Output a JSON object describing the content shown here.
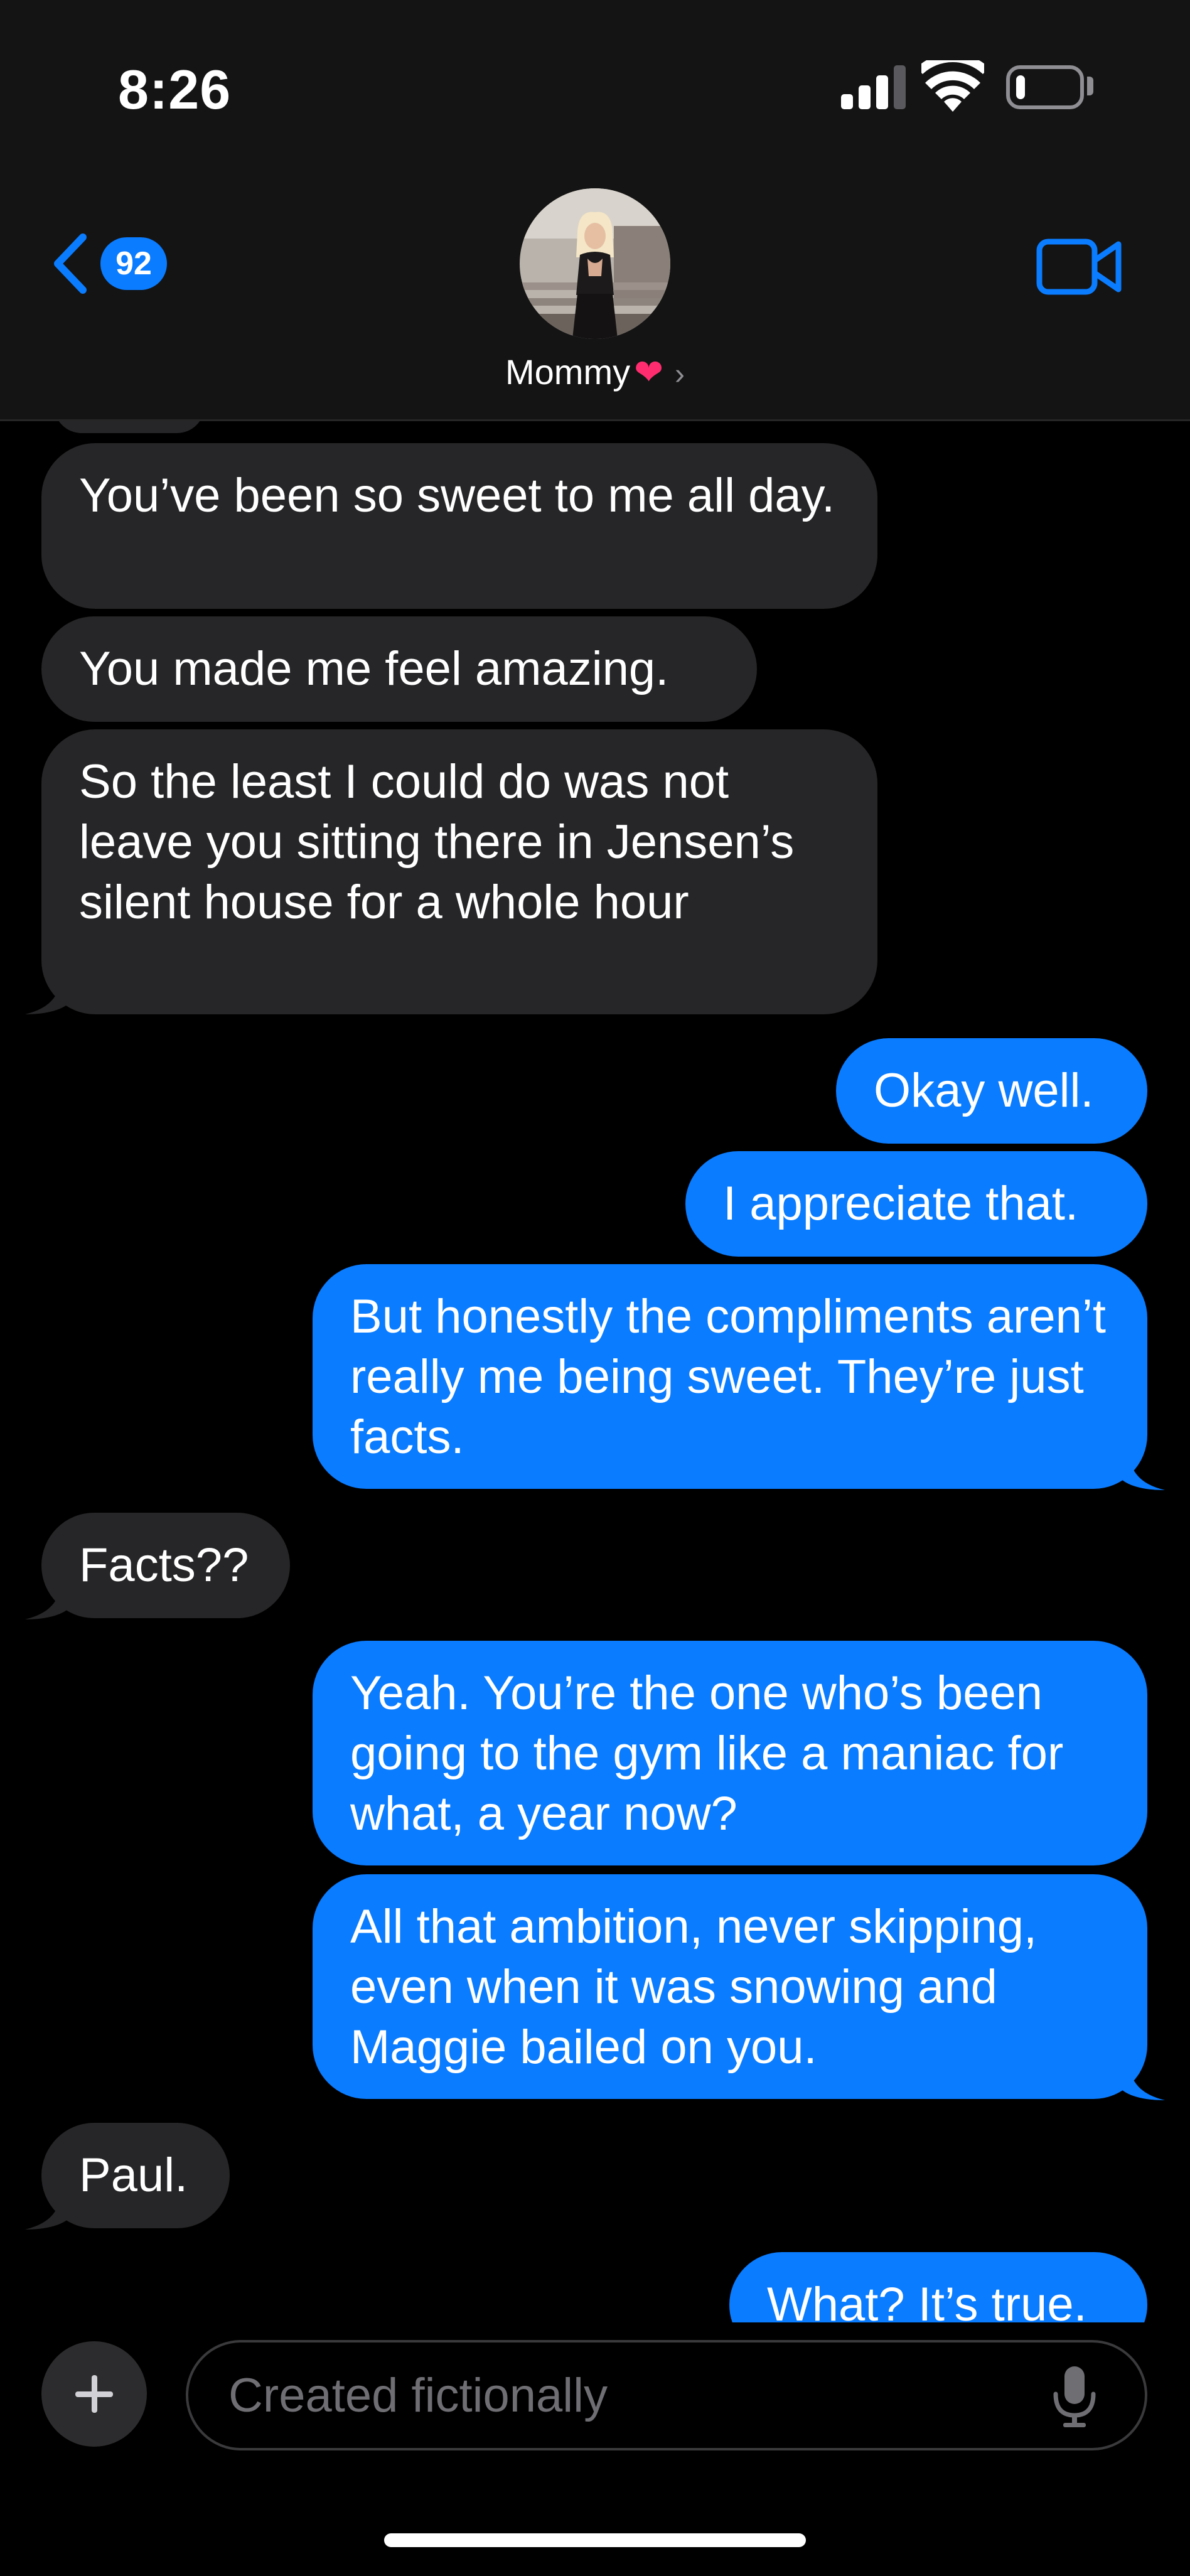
{
  "status_bar": {
    "time": "8:26",
    "signal_icon": "cellular-signal-icon",
    "wifi_icon": "wifi-icon",
    "battery_icon": "battery-icon",
    "battery_level": 0.15
  },
  "header": {
    "back_icon": "chevron-left-icon",
    "unread_count": "92",
    "contact_name": "Mommy",
    "contact_emoji": "❤",
    "contact_chevron": "›",
    "video_icon": "video-camera-icon"
  },
  "messages": [
    {
      "direction": "incoming",
      "text": "You’ve been so sweet to me all day."
    },
    {
      "direction": "incoming",
      "text": "You made me feel amazing."
    },
    {
      "direction": "incoming",
      "text": "So the least I could do was not leave you sitting there in Jensen’s silent house for a whole hour"
    },
    {
      "direction": "outgoing",
      "text": "Okay well."
    },
    {
      "direction": "outgoing",
      "text": "I appreciate that."
    },
    {
      "direction": "outgoing",
      "text": "But honestly the compliments aren’t really me being sweet. They’re just facts."
    },
    {
      "direction": "incoming",
      "text": "Facts??"
    },
    {
      "direction": "outgoing",
      "text": "Yeah. You’re the one who’s been going to the gym like a maniac for what, a year now?"
    },
    {
      "direction": "outgoing",
      "text": "All that ambition, never skipping, even when it was snowing and Maggie bailed on you."
    },
    {
      "direction": "incoming",
      "text": "Paul."
    },
    {
      "direction": "outgoing",
      "text": "What? It’s true."
    }
  ],
  "composer": {
    "placeholder": "Created fictionally",
    "plus_icon": "plus-icon",
    "mic_icon": "microphone-icon"
  },
  "colors": {
    "incoming_bubble": "#262628",
    "outgoing_bubble": "#0a7cff",
    "accent": "#0a7cff",
    "header_bg": "#141414"
  }
}
